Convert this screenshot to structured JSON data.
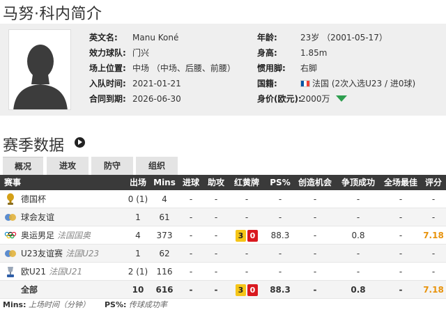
{
  "page_title": "马努·科内简介",
  "profile": {
    "left": [
      {
        "label": "英文名:",
        "value": "Manu Koné"
      },
      {
        "label": "效力球队:",
        "value": "门兴"
      },
      {
        "label": "场上位置:",
        "value": "中场 （中场、后腰、前腰）"
      },
      {
        "label": "入队时间:",
        "value": "2021-01-21"
      },
      {
        "label": "合同到期:",
        "value": "2026-06-30"
      }
    ],
    "right": [
      {
        "label": "年龄:",
        "value": "23岁 （2001-05-17）"
      },
      {
        "label": "身高:",
        "value": "1.85m"
      },
      {
        "label": "惯用脚:",
        "value": "右脚"
      },
      {
        "label": "国籍:",
        "value": "法国 (2次入选U23 / 进0球)"
      },
      {
        "label": "身价(欧元):",
        "value": "2000万"
      }
    ]
  },
  "season": {
    "title": "赛季数据",
    "tabs": [
      "概况",
      "进攻",
      "防守",
      "组织"
    ],
    "active_tab": "概况"
  },
  "table": {
    "headers": [
      "赛事",
      "出场",
      "Mins",
      "进球",
      "助攻",
      "红黄牌",
      "PS%",
      "创造机会",
      "争顶成功",
      "全场最佳",
      "评分"
    ],
    "rows": [
      {
        "comp": "德国杯",
        "team": "",
        "apps": "0 (1)",
        "mins": "4",
        "goals": "-",
        "assists": "-",
        "yellow": "",
        "red": "",
        "cards": "-",
        "ps": "-",
        "chances": "-",
        "aerial": "-",
        "motm": "-",
        "rating": "-",
        "icon": "trophy-icon"
      },
      {
        "comp": "球会友谊",
        "team": "",
        "apps": "1",
        "mins": "61",
        "goals": "-",
        "assists": "-",
        "yellow": "",
        "red": "",
        "cards": "-",
        "ps": "-",
        "chances": "-",
        "aerial": "-",
        "motm": "-",
        "rating": "-",
        "icon": "friendly-icon"
      },
      {
        "comp": "奥运男足",
        "team": "法国国奥",
        "apps": "4",
        "mins": "373",
        "goals": "-",
        "assists": "-",
        "yellow": "3",
        "red": "0",
        "cards": "",
        "ps": "88.3",
        "chances": "-",
        "aerial": "0.8",
        "motm": "-",
        "rating": "7.18",
        "icon": "olympic-rings-icon"
      },
      {
        "comp": "U23友谊赛",
        "team": "法国U23",
        "apps": "1",
        "mins": "62",
        "goals": "-",
        "assists": "-",
        "yellow": "",
        "red": "",
        "cards": "-",
        "ps": "-",
        "chances": "-",
        "aerial": "-",
        "motm": "-",
        "rating": "-",
        "icon": "friendly-icon"
      },
      {
        "comp": "欧U21",
        "team": "法国U21",
        "apps": "2 (1)",
        "mins": "116",
        "goals": "-",
        "assists": "-",
        "yellow": "",
        "red": "",
        "cards": "-",
        "ps": "-",
        "chances": "-",
        "aerial": "-",
        "motm": "-",
        "rating": "-",
        "icon": "euro-u21-icon"
      }
    ],
    "total": {
      "comp": "全部",
      "apps": "10",
      "mins": "616",
      "goals": "-",
      "assists": "-",
      "yellow": "3",
      "red": "0",
      "ps": "88.3",
      "chances": "-",
      "aerial": "0.8",
      "motm": "-",
      "rating": "7.18"
    }
  },
  "footnote": {
    "mins_key": "Mins:",
    "mins_desc": "上场时间（分钟）",
    "ps_key": "PS%:",
    "ps_desc": "传球成功率"
  },
  "colors": {
    "rating": "#e8930c",
    "yellow_card": "#f5c518",
    "red_card": "#d9191f",
    "trend_down": "#2e9e4f",
    "header_bg": "#3a3a3a"
  }
}
